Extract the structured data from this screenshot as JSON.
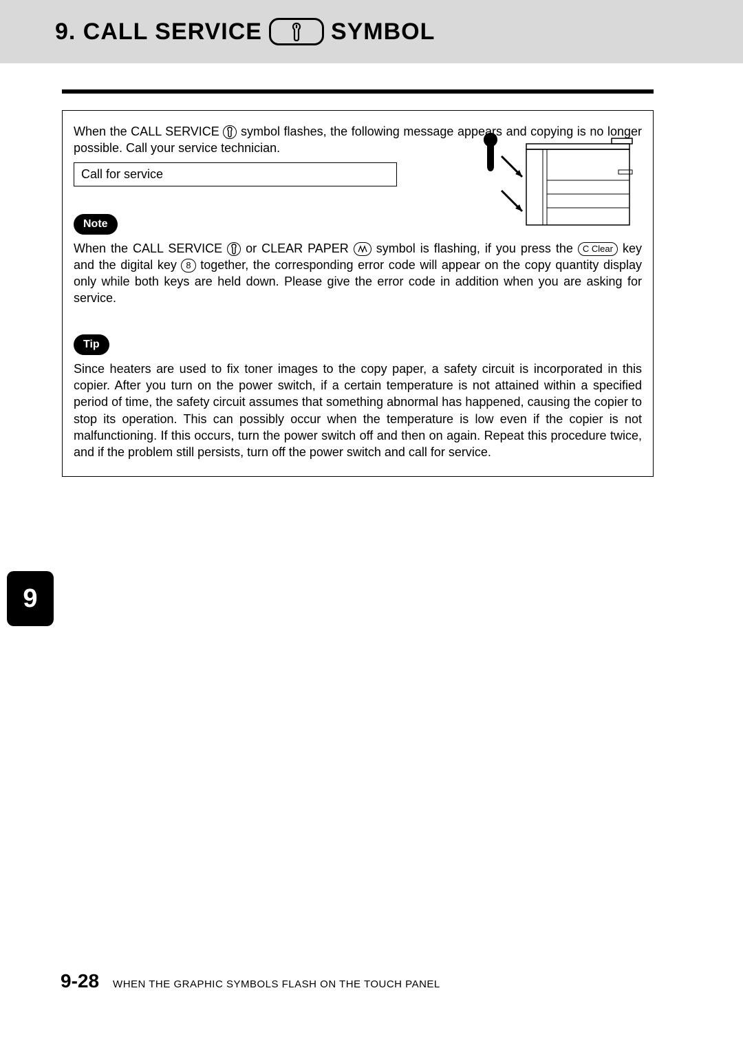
{
  "header": {
    "title_left": "9. CALL SERVICE",
    "title_right": "SYMBOL"
  },
  "intro": {
    "line1_a": "When the CALL SERVICE ",
    "line1_b": "symbol flashes, the following message appears and copying is no longer possible. Call your service technician."
  },
  "message_box": "Call for service",
  "note": {
    "label": "Note",
    "t1": "When the CALL SERVICE ",
    "t2": "or CLEAR PAPER ",
    "t3": " symbol is flashing, if you press the",
    "clear_key": "C Clear",
    "t4": "key and the digital key ",
    "eight_key": "8",
    "t5": "together, the corresponding error code will appear on the copy quantity display only while both keys are held down. Please give the error code in addition when you are asking for service."
  },
  "tip": {
    "label": "Tip",
    "text": "Since heaters are used to fix toner images to the copy paper, a safety circuit is incorporated in this copier. After you turn on the power switch, if a certain temperature is not attained within a specified period of time, the safety circuit assumes that something abnormal has happened, causing the copier to stop its operation. This can possibly occur when the temperature is low even if the copier is not malfunctioning. If this occurs, turn the power switch off and then on again. Repeat this procedure twice, and if the problem still persists, turn off the power switch and call for service."
  },
  "side_tab": "9",
  "footer": {
    "page": "9-28",
    "text": "WHEN THE GRAPHIC SYMBOLS FLASH ON THE TOUCH PANEL"
  }
}
